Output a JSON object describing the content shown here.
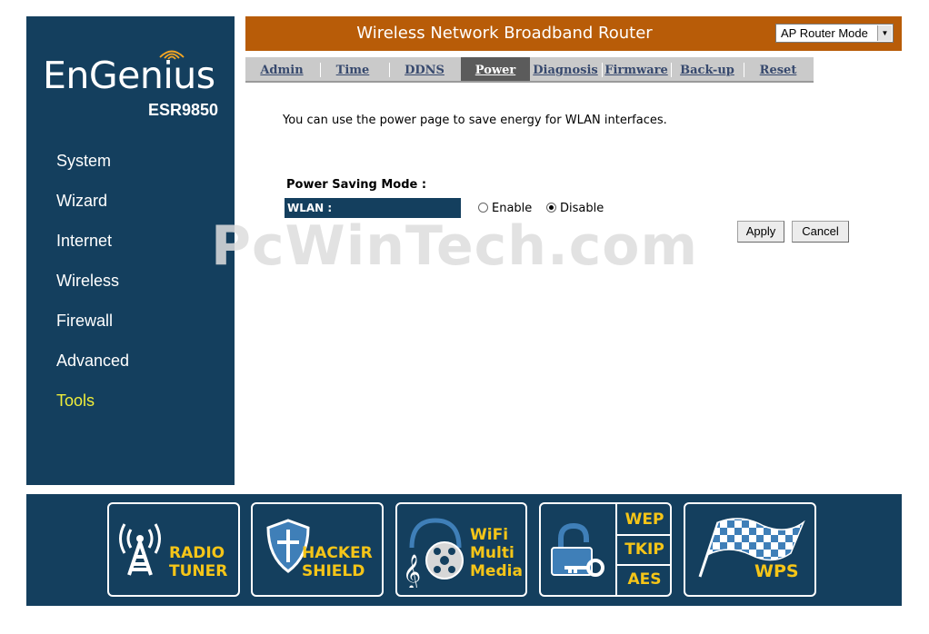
{
  "brand": {
    "logo_text": "EnGenius",
    "model": "ESR9850"
  },
  "sidebar": {
    "items": [
      {
        "label": "System",
        "active": false
      },
      {
        "label": "Wizard",
        "active": false
      },
      {
        "label": "Internet",
        "active": false
      },
      {
        "label": "Wireless",
        "active": false
      },
      {
        "label": "Firewall",
        "active": false
      },
      {
        "label": "Advanced",
        "active": false
      },
      {
        "label": "Tools",
        "active": true
      }
    ]
  },
  "header": {
    "title": "Wireless Network Broadband Router",
    "mode_select": {
      "value": "AP Router Mode"
    }
  },
  "tabs": [
    {
      "label": "Admin",
      "active": false
    },
    {
      "label": "Time",
      "active": false
    },
    {
      "label": "DDNS",
      "active": false
    },
    {
      "label": "Power",
      "active": true
    },
    {
      "label": "Diagnosis",
      "active": false
    },
    {
      "label": "Firmware",
      "active": false
    },
    {
      "label": "Back-up",
      "active": false
    },
    {
      "label": "Reset",
      "active": false
    }
  ],
  "content": {
    "intro": "You can use the power page to save energy for WLAN interfaces.",
    "power_saving_label": "Power Saving Mode :",
    "wlan_label": "WLAN :",
    "options": [
      {
        "label": "Enable",
        "checked": false
      },
      {
        "label": "Disable",
        "checked": true
      }
    ],
    "apply_label": "Apply",
    "cancel_label": "Cancel"
  },
  "watermark": "PcWinTech.com",
  "footer": {
    "badges": [
      {
        "line1": "RADIO",
        "line2": "TUNER",
        "icon": "radio-tower-icon"
      },
      {
        "line1": "HACKER",
        "line2": "SHIELD",
        "icon": "shield-icon"
      },
      {
        "line1": "WiFi",
        "line2": "Multi",
        "line3": "Media",
        "icon": "media-icon"
      },
      {
        "line1": "WEP",
        "line2": "TKIP",
        "line3": "AES",
        "icon": "lock-icon"
      },
      {
        "line1": "WPS",
        "icon": "checkered-flag-icon"
      }
    ]
  },
  "colors": {
    "navy": "#143f5e",
    "orange": "#b85c08",
    "yellow": "#f5c518",
    "active_nav": "#f0ee3a"
  }
}
